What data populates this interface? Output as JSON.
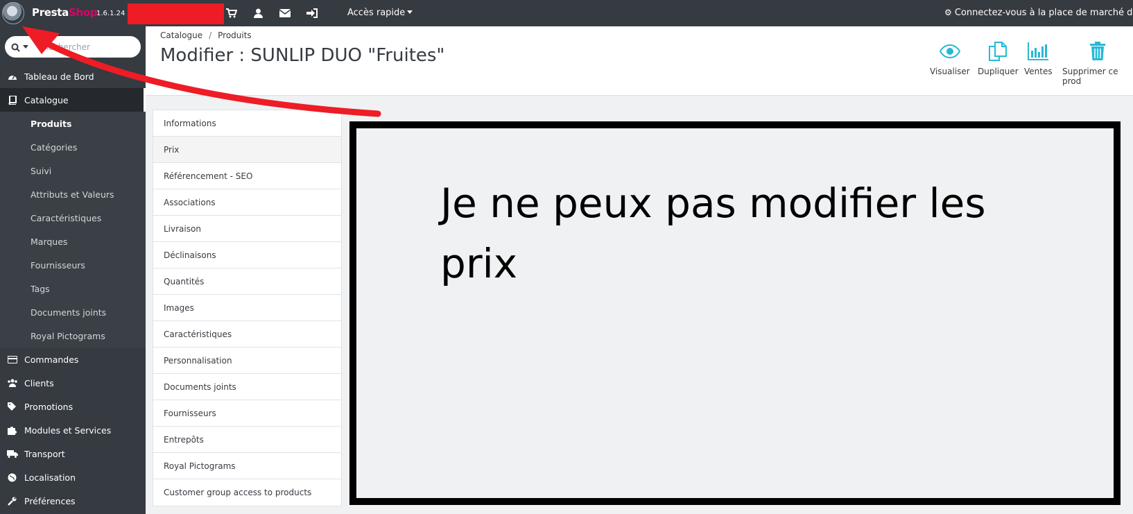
{
  "topbar": {
    "brand_part1": "Presta",
    "brand_part2": "Shop",
    "version": "1.6.1.24",
    "quick_access": "Accès rapide",
    "marketplace": "Connectez-vous à la place de marché de Presta"
  },
  "search": {
    "placeholder": "Rechercher"
  },
  "sidebar": {
    "items_top": [
      {
        "label": "Tableau de Bord",
        "icon": "dashboard-icon"
      },
      {
        "label": "Catalogue",
        "icon": "book-icon"
      }
    ],
    "catalogue_sub": [
      "Produits",
      "Catégories",
      "Suivi",
      "Attributs et Valeurs",
      "Caractéristiques",
      "Marques",
      "Fournisseurs",
      "Tags",
      "Documents joints",
      "Royal Pictograms"
    ],
    "items_bottom": [
      {
        "label": "Commandes",
        "icon": "credit-card-icon"
      },
      {
        "label": "Clients",
        "icon": "users-icon"
      },
      {
        "label": "Promotions",
        "icon": "tags-icon"
      },
      {
        "label": "Modules et Services",
        "icon": "puzzle-icon"
      },
      {
        "label": "Transport",
        "icon": "truck-icon"
      },
      {
        "label": "Localisation",
        "icon": "globe-icon"
      },
      {
        "label": "Préférences",
        "icon": "wrench-icon"
      }
    ]
  },
  "header": {
    "breadcrumb": [
      "Catalogue",
      "Produits"
    ],
    "title": "Modifier : SUNLIP DUO \"Fruites\"",
    "toolbar": {
      "view": "Visualiser",
      "duplicate": "Dupliquer",
      "sales": "Ventes",
      "delete": "Supprimer ce prod"
    }
  },
  "tabs": [
    "Informations",
    "Prix",
    "Référencement - SEO",
    "Associations",
    "Livraison",
    "Déclinaisons",
    "Quantités",
    "Images",
    "Caractéristiques",
    "Personnalisation",
    "Documents joints",
    "Fournisseurs",
    "Entrepôts",
    "Royal Pictograms",
    "Customer group access to products"
  ],
  "note": {
    "text": "Je ne peux pas modifier les prix"
  },
  "colors": {
    "accent": "#25b9d7",
    "dark": "#363a41",
    "brand_pink": "#df0067",
    "annotation_red": "#ee1c25"
  }
}
